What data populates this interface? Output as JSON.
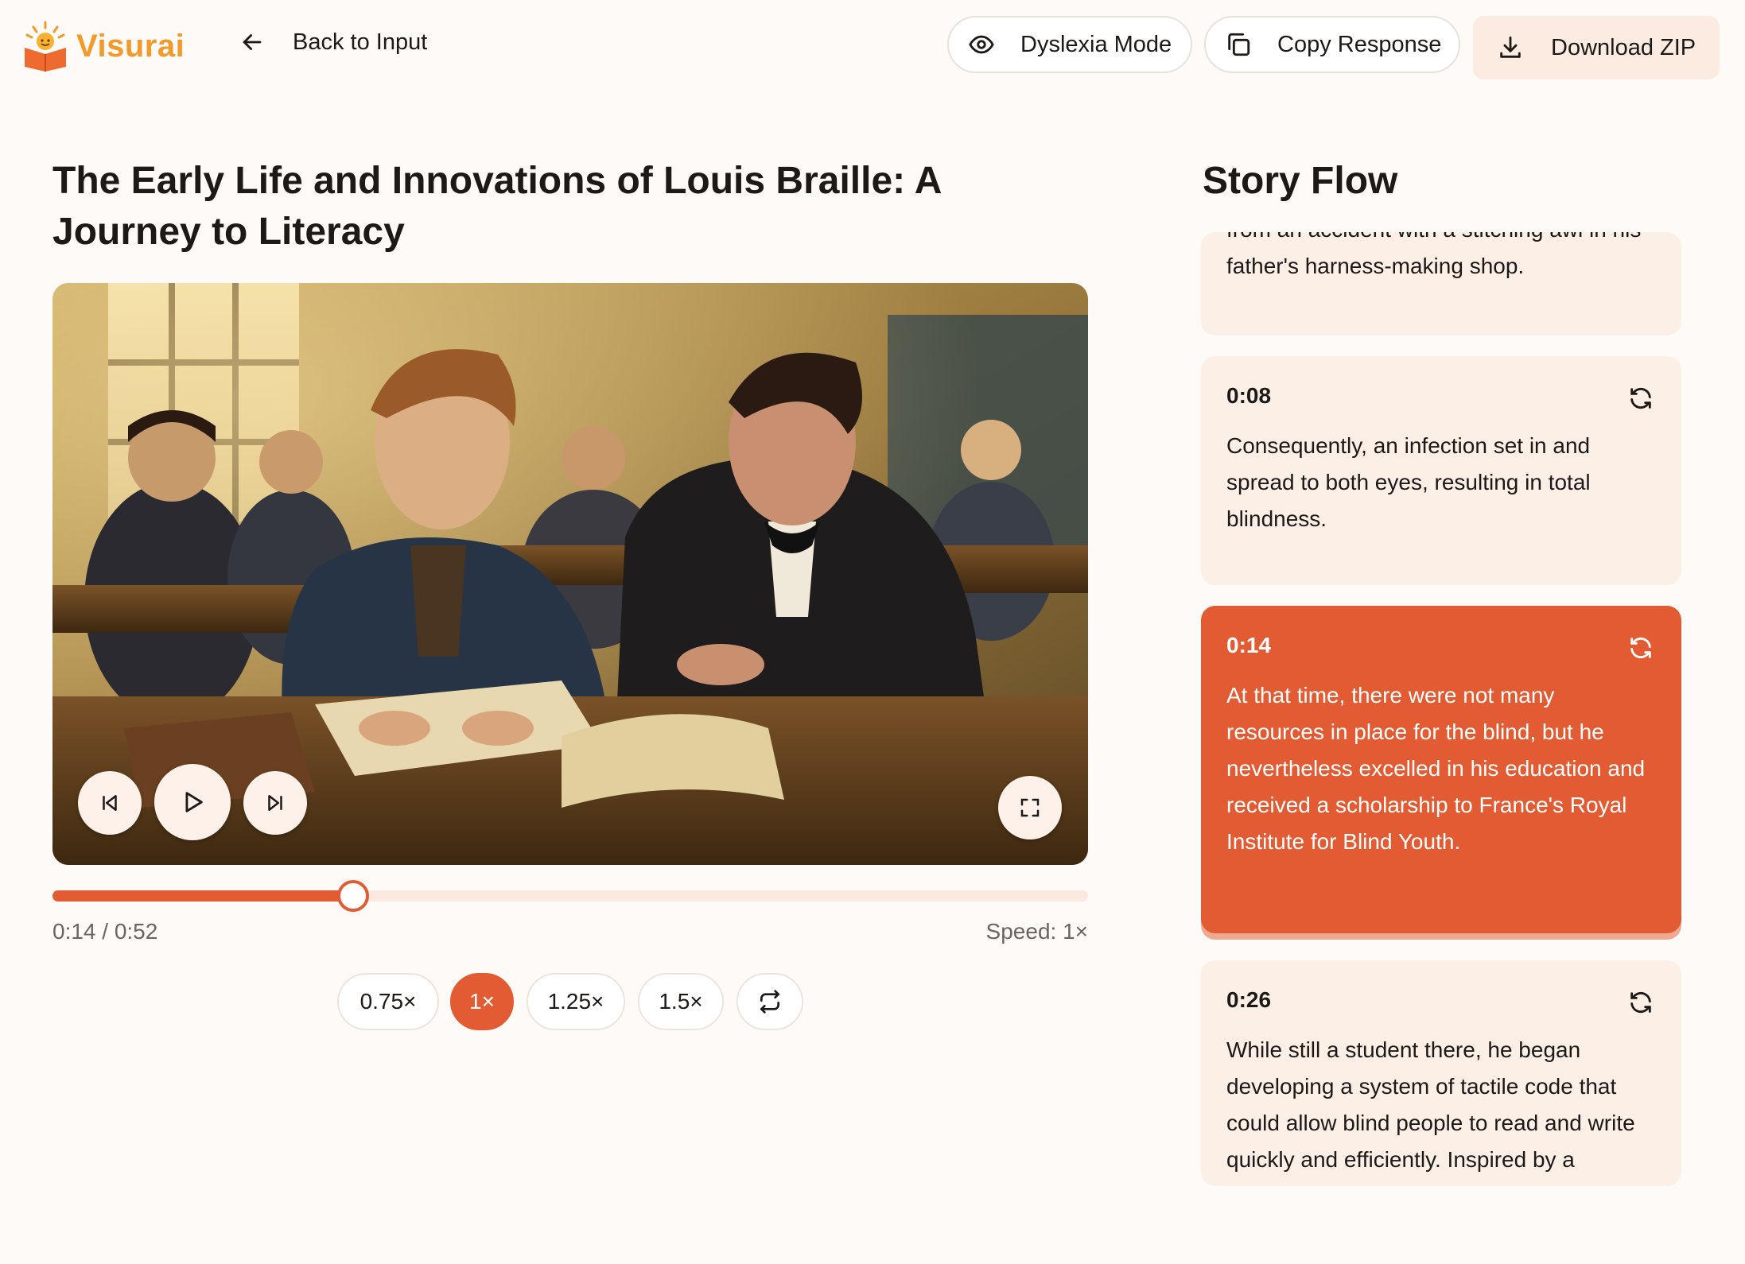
{
  "header": {
    "logo_text": "Visurai",
    "back_label": "Back to Input",
    "dyslexia_label": "Dyslexia Mode",
    "copy_label": "Copy Response",
    "download_label": "Download ZIP"
  },
  "story": {
    "title": "The Early Life and Innovations of Louis Braille: A Journey to Literacy"
  },
  "player": {
    "current_time": "0:14",
    "total_time": "0:52",
    "time_display": "0:14 / 0:52",
    "progress_fraction": 0.29,
    "speed_display": "Speed: 1×",
    "speed_options": [
      "0.75×",
      "1×",
      "1.25×",
      "1.5×"
    ],
    "active_speed": "1×"
  },
  "flow": {
    "title": "Story Flow",
    "items": [
      {
        "time": "",
        "text": "from an accident with a stitching awl in his father's harness-making shop."
      },
      {
        "time": "0:08",
        "text": "Consequently, an infection set in and spread to both eyes, resulting in total blindness."
      },
      {
        "time": "0:14",
        "text": "At that time, there were not many resources in place for the blind, but he nevertheless excelled in his education and received a scholarship to France's Royal Institute for Blind Youth.",
        "active": true
      },
      {
        "time": "0:26",
        "text": "While still a student there, he began developing a system of tactile code that could allow blind people to read and write quickly and efficiently. Inspired by a"
      }
    ]
  },
  "colors": {
    "accent": "#e35b33",
    "logo": "#f39a2a",
    "card_bg": "#fcefe6",
    "page_bg": "#fdfaf8"
  },
  "icons": {
    "back": "arrow-left-icon",
    "dyslexia": "eye-icon",
    "copy": "copy-icon",
    "download": "download-icon",
    "refresh": "refresh-icon",
    "prev": "skip-back-icon",
    "play": "play-icon",
    "next": "skip-forward-icon",
    "fullscreen": "fullscreen-icon",
    "loop": "repeat-icon"
  }
}
